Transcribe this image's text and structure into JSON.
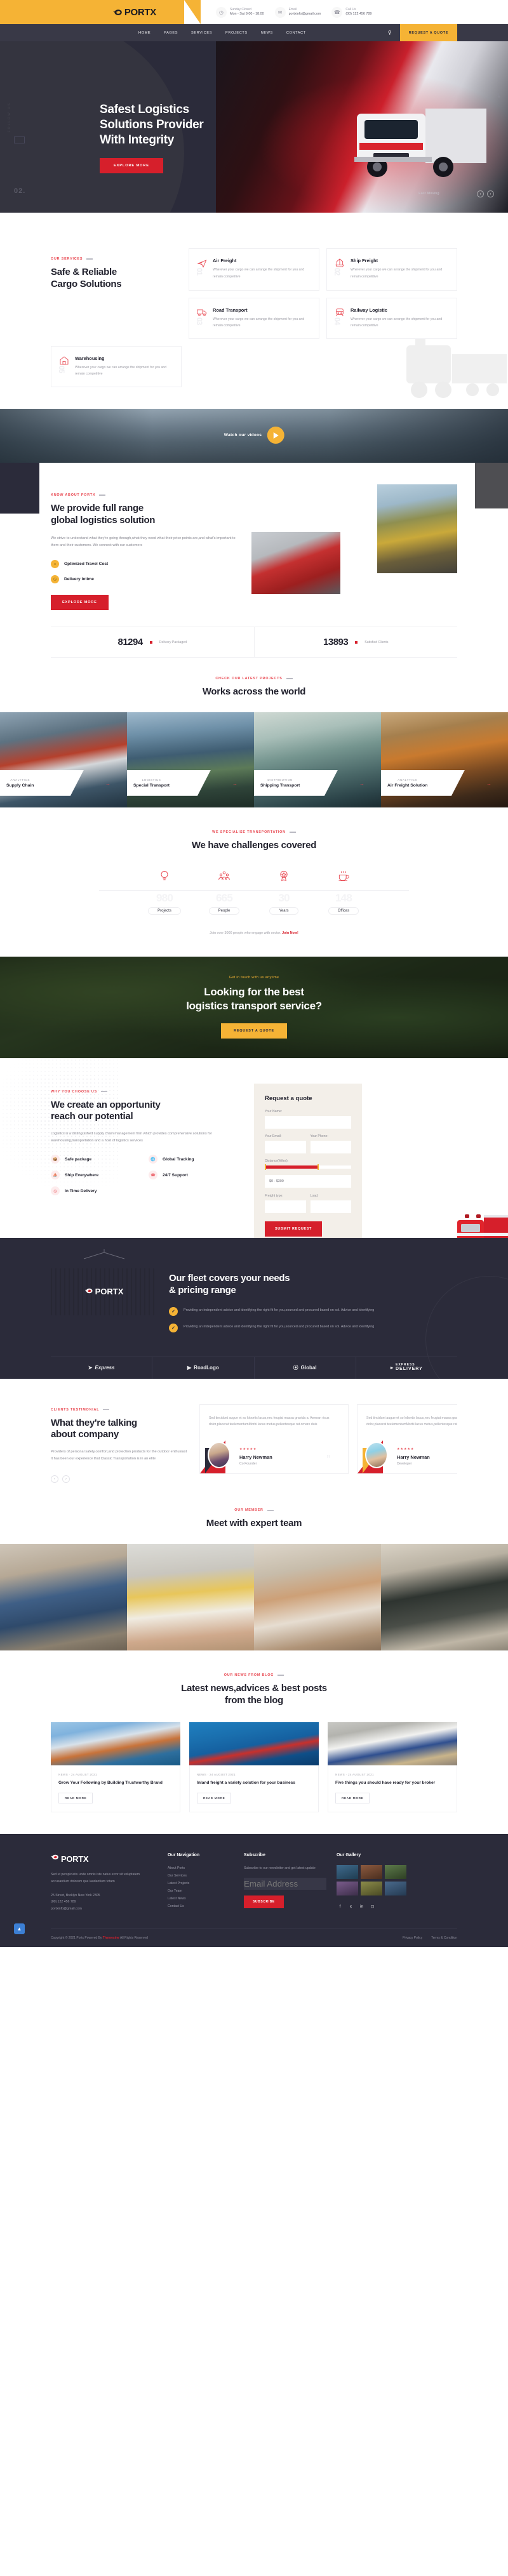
{
  "brand": {
    "name": "PORTX",
    "icon": "portx-logo-icon"
  },
  "topbar": {
    "info": [
      {
        "icon": "clock-icon",
        "label": "Sunday Closed",
        "value": "Mon - Sat 9:00 - 18:00"
      },
      {
        "icon": "envelope-icon",
        "label": "Email",
        "value": "portxinfo@gmail.com"
      },
      {
        "icon": "phone-icon",
        "label": "Call Us",
        "value": "(00) 122 456 789"
      }
    ]
  },
  "nav": {
    "links": [
      "HOME",
      "PAGES",
      "SERVICES",
      "PROJECTS",
      "NEWS",
      "CONTACT"
    ],
    "search_icon": "search-icon",
    "quote_label": "REQUEST A QUOTE"
  },
  "hero": {
    "side_text": "FOLLOW US",
    "title_line1": "Safest Logistics",
    "title_line2": "Solutions Provider",
    "title_line3": "With Integrity",
    "button": "EXPLORE MORE",
    "slide_number": "02.",
    "caption": "Fast Moving",
    "prev_icon": "‹",
    "next_icon": "›"
  },
  "services": {
    "eyebrow": "OUR SERVICES",
    "title_line1": "Safe & Reliable",
    "title_line2": "Cargo Solutions",
    "cards": [
      {
        "num": "01",
        "icon": "airplane-icon",
        "name": "Air Freight",
        "desc": "Wherever your cargo we can arrange the shipment for you and remain competitive"
      },
      {
        "num": "02",
        "icon": "ship-icon",
        "name": "Ship Freight",
        "desc": "Wherever your cargo we can arrange the shipment for you and remain competitive"
      },
      {
        "num": "03",
        "icon": "truck-icon",
        "name": "Road Transport",
        "desc": "Wherever your cargo we can arrange the shipment for you and remain competitive"
      },
      {
        "num": "04",
        "icon": "train-icon",
        "name": "Railway Logistic",
        "desc": "Wherever your cargo we can arrange the shipment for you and remain competitive"
      },
      {
        "num": "05",
        "icon": "warehouse-icon",
        "name": "Warehousing",
        "desc": "Wherever your cargo we can arrange the shipment for you and remain competitive"
      }
    ]
  },
  "video": {
    "label": "Watch our videos",
    "play_icon": "play-icon"
  },
  "about": {
    "eyebrow": "KNOW ABOUT PORTX",
    "title_line1": "We provide full range",
    "title_line2": "global logistics solution",
    "paragraph": "We strive to understand what they're going through,what they need what their price points are,and what's important to them and their customers. We connect with our customers",
    "features": [
      {
        "icon": "cost-icon",
        "label": "Optimized Travel Cost"
      },
      {
        "icon": "clock-icon",
        "label": "Delivery Intime"
      }
    ],
    "button": "EXPLORE MORE"
  },
  "counters": [
    {
      "number": "81294",
      "label": "Delivery Packaged"
    },
    {
      "number": "13893",
      "label": "Satisfied Clients"
    }
  ],
  "projects": {
    "eyebrow": "CHECK OUR LATEST PROJECTS",
    "title": "Works across the world",
    "items": [
      {
        "category": "ANALYTICS",
        "name": "Supply Chain",
        "arrow": "→"
      },
      {
        "category": "LOGISTICS",
        "name": "Special Transport",
        "arrow": "→"
      },
      {
        "category": "DISTRIBUTION",
        "name": "Shipping Transport",
        "arrow": "→"
      },
      {
        "category": "ANALYTICS",
        "name": "Air Freight Solution",
        "arrow": "→"
      }
    ]
  },
  "challenges": {
    "eyebrow": "WE SPECIALISE TRANSPORTATION",
    "title": "We have challenges covered",
    "stats": [
      {
        "icon": "idea-icon",
        "number": "980",
        "label": "Projects"
      },
      {
        "icon": "people-icon",
        "number": "665",
        "label": "People"
      },
      {
        "icon": "award-icon",
        "number": "30",
        "label": "Years"
      },
      {
        "icon": "coffee-icon",
        "number": "148",
        "label": "Offices"
      }
    ],
    "join_text": "Join over 3000 people who engage with sector.",
    "join_link": "Join Now!"
  },
  "bigcta": {
    "eyebrow": "Get in touch with us anytime",
    "title_line1": "Looking for the best",
    "title_line2": "logistics transport service?",
    "button": "REQUEST A QUOTE"
  },
  "why": {
    "eyebrow": "Why you Choose us",
    "title_line1": "We create an opportunity",
    "title_line2": "reach our potential",
    "paragraph": "Logistics is a distinguished supply chain management firm which provides comprehensive solutions for warehousing,transportation and a host of logistics services",
    "features": [
      {
        "icon": "package-icon",
        "label": "Safe package"
      },
      {
        "icon": "globe-icon",
        "label": "Global Tracking"
      },
      {
        "icon": "ship-icon",
        "label": "Ship Everywhere"
      },
      {
        "icon": "headset-icon",
        "label": "24/7 Support"
      },
      {
        "icon": "clock-icon",
        "label": "In Time Delivery"
      }
    ]
  },
  "quote_form": {
    "title": "Request a quote",
    "name_label": "Your Name:",
    "name_value": "",
    "email_label": "Your Email:",
    "email_value": "",
    "phone_label": "Your Phone:",
    "phone_value": "",
    "distance_label": "Distance(Miles):",
    "range_value": "$0 - $300",
    "freight_label": "Freight type:",
    "freight_value": "",
    "load_label": "Load:",
    "load_value": "",
    "submit_label": "SUBMIT REQUEST"
  },
  "fleet": {
    "title_line1": "Our fleet covers your needs",
    "title_line2": "& pricing range",
    "points": [
      "Providing an independent advice and identifying the right fit for you,sourced and procured based on sol. Advice and identifying",
      "Providing an independent advice and identifying the right fit for you,sourced and procured based on sol. Advice and identifying"
    ],
    "container_brand": "PORTX",
    "brands": [
      {
        "icon": "arrow-brand-icon",
        "name": "Express"
      },
      {
        "icon": "road-brand-icon",
        "name": "RoadLogo"
      },
      {
        "icon": "globe-brand-icon",
        "name": "Global"
      },
      {
        "icon": "delivery-brand-icon",
        "name": "EXPRESS",
        "name2": "DELIVERY"
      }
    ]
  },
  "testimonials": {
    "eyebrow": "CLIENTS TESTIMONIAL",
    "title_line1": "What they're talking",
    "title_line2": "about company",
    "paragraph": "Providers of personal safety,comfort,and protection products for the outdoor enthusiast It has been our experience that Classic Transportation is in an elite",
    "prev_icon": "‹",
    "next_icon": "›",
    "items": [
      {
        "text": "Sed tincidunt augue et so lobortis lacus,nec feugiat massa gravida a. Aenean risus dolor,placerat teelementumMorbi lacus metus,pellentesque rat ornare duis",
        "stars": "★★★★★",
        "name": "Harry Newman",
        "role": "Co Founder",
        "quote_icon": "”"
      },
      {
        "text": "Sed tincidunt augue et so lobortis lacus,nec feugiat massa gravida a. Aenean risus dolor,placerat teelementumMorbi lacus metus,pellentesque rat ornare duis",
        "stars": "★★★★★",
        "name": "Harry Newman",
        "role": "Developer",
        "quote_icon": "”"
      }
    ]
  },
  "team": {
    "eyebrow": "Our Member",
    "title": "Meet with expert team",
    "members": [
      "team-member-1",
      "team-member-2",
      "team-member-3",
      "team-member-4"
    ]
  },
  "blog": {
    "eyebrow": "Our News From Blog",
    "title_line1": "Latest news,advices & best posts",
    "title_line2": "from the blog",
    "posts": [
      {
        "meta": "NEWS · 24 AUGUST 2021",
        "title": "Grow Your Following by Building Trustworthy Brand",
        "button": "READ MORE"
      },
      {
        "meta": "NEWS · 24 AUGUST 2021",
        "title": "Inland freight a variety solution for your business",
        "button": "READ MORE"
      },
      {
        "meta": "NEWS · 24 AUGUST 2021",
        "title": "Five things you should have ready for your broker",
        "button": "READ MORE"
      }
    ]
  },
  "footer": {
    "about_text": "Sed ut perspiciatis unde omnis iste natus error sit voluptatem accusantium dolorem que laudantium totam",
    "address": "25 Street, Broklyn New York 2305",
    "phone": "(00) 122 456 789",
    "email": "portxinfo@gmail.com",
    "nav_title": "Our Navigation",
    "nav_links": [
      "About Portx",
      "Our Services",
      "Latest Projects",
      "Our Team",
      "Latest News",
      "Contact Us"
    ],
    "subscribe_title": "Subscribe",
    "subscribe_text": "Subscribe to our newsletter and get latest update",
    "subscribe_placeholder": "Email Address",
    "subscribe_button": "SUBSCRIBE",
    "gallery_title": "Our Gallery",
    "social": [
      "facebook-icon",
      "twitter-icon",
      "linkedin-icon",
      "instagram-icon"
    ],
    "copyright_pre": "Copyright © 2021 Portx Powered By",
    "copyright_brand": "Themesine",
    "copyright_post": "All Rights Reserved",
    "bottom_links": [
      "Privacy Policy",
      "Terms & Condition"
    ],
    "scroll_icon": "scroll-top-icon"
  },
  "colors": {
    "yellow": "#f5b335",
    "red": "#d61f2b",
    "accent_red": "#e8464f",
    "dark": "#2b2b3a",
    "nav_dark": "#393947"
  }
}
